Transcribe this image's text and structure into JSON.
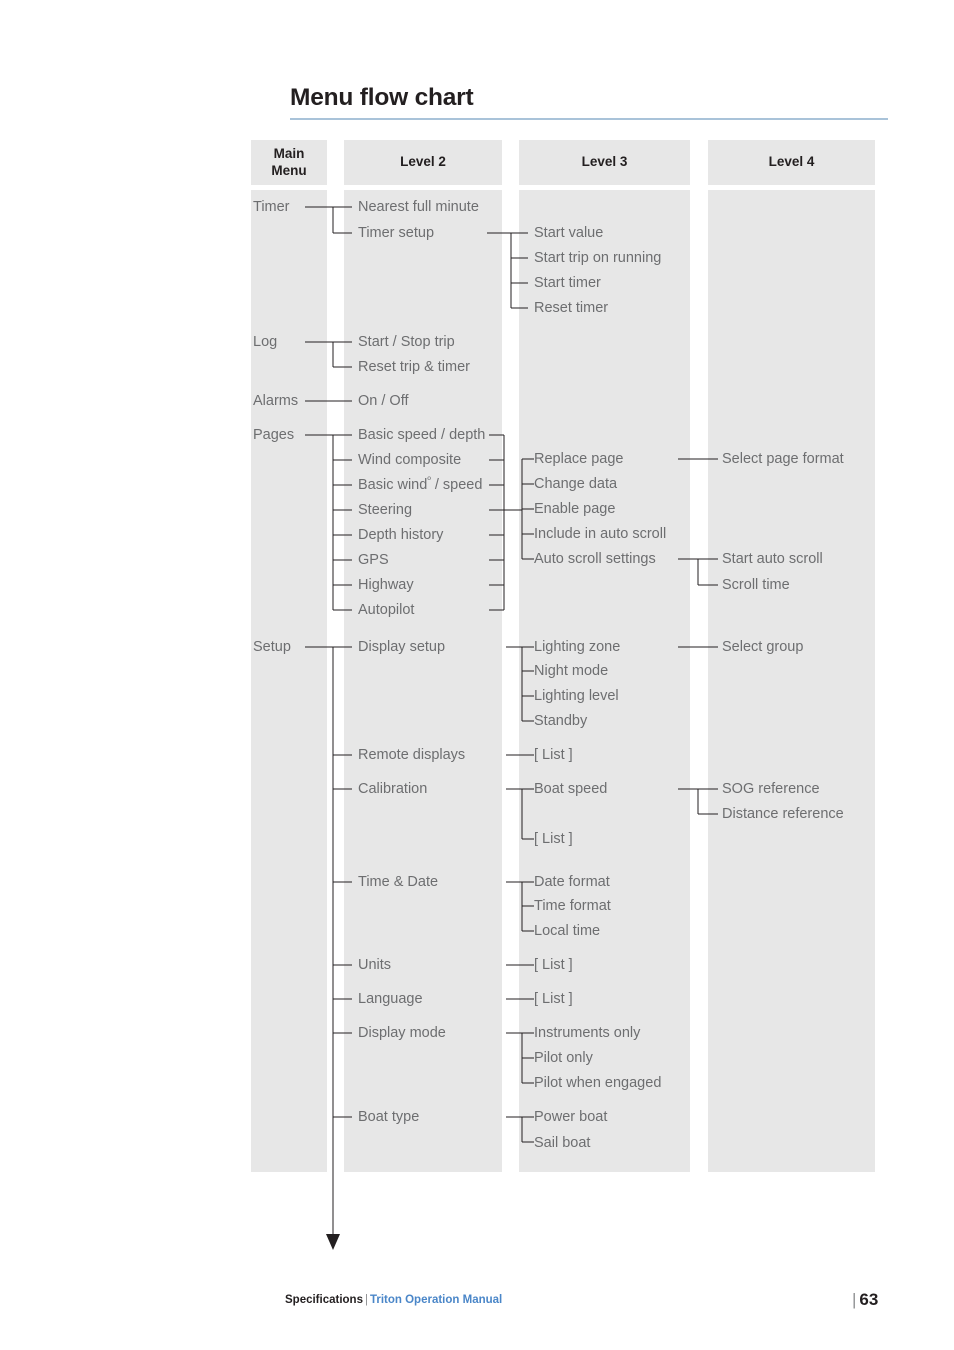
{
  "page": {
    "title": "Menu flow chart",
    "accent_rule_color": "#a9c3d9",
    "band_color": "#e7e7e7",
    "label_color": "#6d6e70",
    "heading_color": "#231f20"
  },
  "columns": [
    {
      "id": "main",
      "header": "Main\nMenu",
      "header_line1": "Main",
      "header_line2": "Menu"
    },
    {
      "id": "level2",
      "header": "Level 2"
    },
    {
      "id": "level3",
      "header": "Level 3"
    },
    {
      "id": "level4",
      "header": "Level 4"
    }
  ],
  "nodes": {
    "main_menu": [
      {
        "label": "Timer"
      },
      {
        "label": "Log"
      },
      {
        "label": "Alarms"
      },
      {
        "label": "Pages"
      },
      {
        "label": "Setup"
      }
    ],
    "level2": [
      {
        "label": "Nearest full minute"
      },
      {
        "label": "Timer setup"
      },
      {
        "label": "Start / Stop trip"
      },
      {
        "label": "Reset trip & timer"
      },
      {
        "label": "On / Off"
      },
      {
        "label": "Basic speed / depth"
      },
      {
        "label": "Wind composite"
      },
      {
        "label": "Basic windº / speed",
        "label_base": "Basic wind",
        "label_sup": "º",
        "label_tail": " / speed"
      },
      {
        "label": "Steering"
      },
      {
        "label": "Depth history"
      },
      {
        "label": "GPS"
      },
      {
        "label": "Highway"
      },
      {
        "label": "Autopilot"
      },
      {
        "label": "Display setup"
      },
      {
        "label": "Remote displays"
      },
      {
        "label": "Calibration"
      },
      {
        "label": "Time & Date"
      },
      {
        "label": "Units"
      },
      {
        "label": "Language"
      },
      {
        "label": "Display mode"
      },
      {
        "label": "Boat type"
      }
    ],
    "level3": [
      {
        "label": "Start value"
      },
      {
        "label": "Start trip on running"
      },
      {
        "label": "Start timer"
      },
      {
        "label": "Reset timer"
      },
      {
        "label": "Replace page"
      },
      {
        "label": "Change data"
      },
      {
        "label": "Enable page"
      },
      {
        "label": "Include in auto scroll"
      },
      {
        "label": "Auto scroll settings"
      },
      {
        "label": "Lighting zone"
      },
      {
        "label": "Night mode"
      },
      {
        "label": "Lighting level"
      },
      {
        "label": "Standby"
      },
      {
        "label": "[ List ]"
      },
      {
        "label": "Boat speed"
      },
      {
        "label": "[ List ]"
      },
      {
        "label": "Date format"
      },
      {
        "label": "Time format"
      },
      {
        "label": "Local time"
      },
      {
        "label": "[ List ]"
      },
      {
        "label": "[ List ]"
      },
      {
        "label": "Instruments only"
      },
      {
        "label": "Pilot only"
      },
      {
        "label": "Pilot when engaged"
      },
      {
        "label": "Power boat"
      },
      {
        "label": "Sail boat"
      }
    ],
    "level4": [
      {
        "label": "Select page format"
      },
      {
        "label": "Start auto scroll"
      },
      {
        "label": "Scroll time"
      },
      {
        "label": "Select group"
      },
      {
        "label": "SOG reference"
      },
      {
        "label": "Distance reference"
      }
    ]
  },
  "footer": {
    "section": "Specifications",
    "separator": "|",
    "manual": "Triton Operation Manual",
    "page_bar": "|",
    "page_number": "63"
  }
}
